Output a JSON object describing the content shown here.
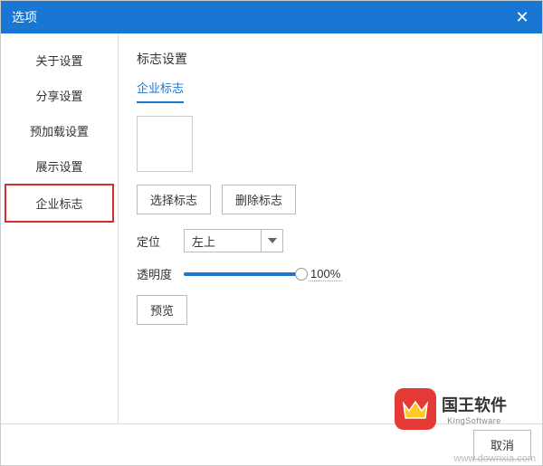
{
  "titlebar": {
    "title": "选项"
  },
  "sidebar": {
    "items": [
      {
        "label": "关于设置"
      },
      {
        "label": "分享设置"
      },
      {
        "label": "预加载设置"
      },
      {
        "label": "展示设置"
      },
      {
        "label": "企业标志"
      }
    ]
  },
  "content": {
    "section_title": "标志设置",
    "tab_label": "企业标志",
    "select_logo_btn": "选择标志",
    "delete_logo_btn": "删除标志",
    "position_label": "定位",
    "position_value": "左上",
    "opacity_label": "透明度",
    "opacity_value": "100%",
    "preview_btn": "预览"
  },
  "footer": {
    "cancel": "取消"
  },
  "brand": {
    "name": "国王软件",
    "sub": "KingSoftware"
  },
  "watermark": "www.downxia.com"
}
